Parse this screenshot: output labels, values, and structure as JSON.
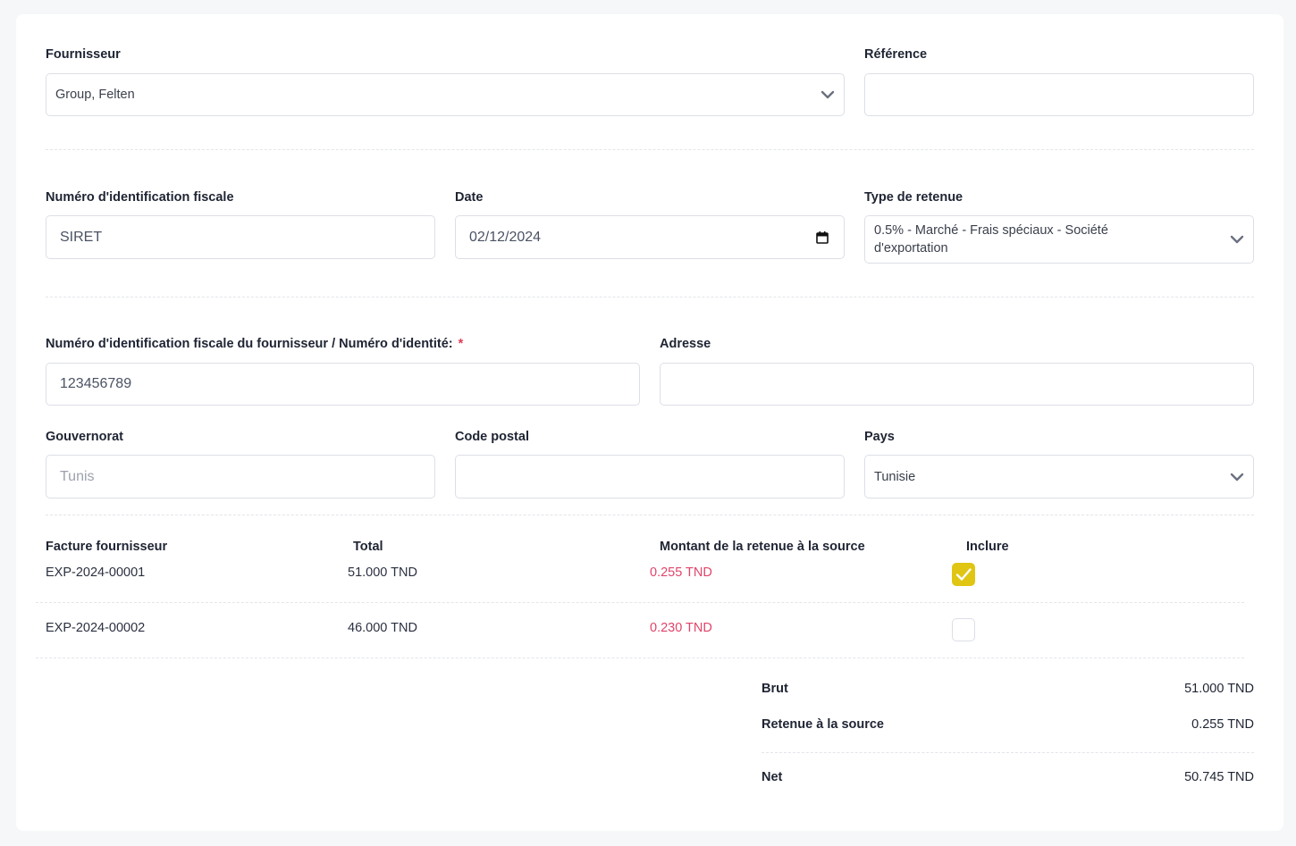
{
  "form": {
    "supplier": {
      "label": "Fournisseur",
      "value": "Group, Felten"
    },
    "reference": {
      "label": "Référence",
      "value": ""
    },
    "tax_id": {
      "label": "Numéro d'identification fiscale",
      "value": "SIRET"
    },
    "date": {
      "label": "Date",
      "value": "02/12/2024"
    },
    "withholding_type": {
      "label": "Type de retenue",
      "value": "0.5% - Marché - Frais spéciaux - Société d'exportation"
    },
    "supplier_tax_id": {
      "label": "Numéro d'identification fiscale du fournisseur / Numéro d'identité:",
      "required_mark": "*",
      "value": "123456789"
    },
    "address": {
      "label": "Adresse",
      "value": ""
    },
    "governorate": {
      "label": "Gouvernorat",
      "placeholder": "Tunis"
    },
    "postal_code": {
      "label": "Code postal",
      "value": ""
    },
    "country": {
      "label": "Pays",
      "value": "Tunisie"
    }
  },
  "invoices": {
    "headers": [
      "Facture fournisseur",
      "Total",
      "Montant de la retenue à la source",
      "Inclure"
    ],
    "rows": [
      {
        "invoice": "EXP-2024-00001",
        "total": "51.000 TND",
        "withholding": "0.255 TND",
        "included": true
      },
      {
        "invoice": "EXP-2024-00002",
        "total": "46.000 TND",
        "withholding": "0.230 TND",
        "included": false
      }
    ]
  },
  "summary": {
    "gross": {
      "label": "Brut",
      "value": "51.000 TND"
    },
    "withholding": {
      "label": "Retenue à la source",
      "value": "0.255 TND"
    },
    "net": {
      "label": "Net",
      "value": "50.745 TND"
    }
  },
  "colors": {
    "accent_checkbox": "#e0c513",
    "withholding_text": "#e0446a"
  },
  "icons": {
    "dropdown": "chevron-down-icon",
    "date": "calendar-icon",
    "check": "check-icon"
  }
}
